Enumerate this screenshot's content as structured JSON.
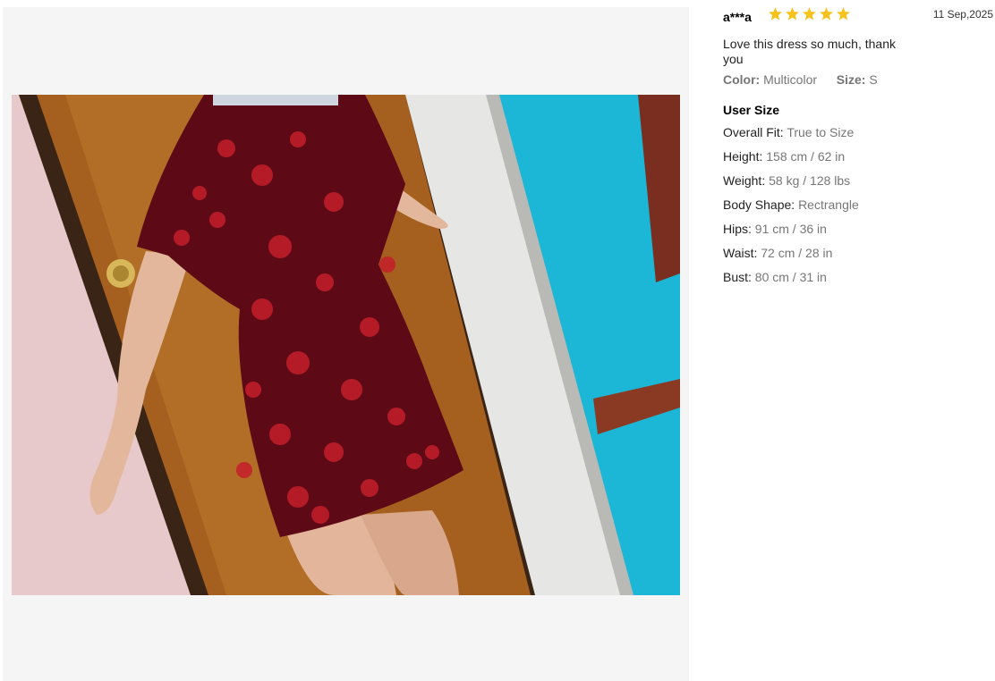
{
  "review": {
    "reviewer": "a***a",
    "rating": 5,
    "date": "11 Sep,2025",
    "text": "Love this dress so much, thank you",
    "color_label": "Color:",
    "color_value": "Multicolor",
    "size_label": "Size:",
    "size_value": "S"
  },
  "user_size": {
    "title": "User Size",
    "items": [
      {
        "label": "Overall Fit:",
        "value": "True to Size"
      },
      {
        "label": "Height:",
        "value": "158 cm / 62 in"
      },
      {
        "label": "Weight:",
        "value": "58 kg / 128 lbs"
      },
      {
        "label": "Body Shape:",
        "value": "Rectrangle"
      },
      {
        "label": "Hips:",
        "value": "91 cm / 36 in"
      },
      {
        "label": "Waist:",
        "value": "72 cm / 28 in"
      },
      {
        "label": "Bust:",
        "value": "80 cm / 31 in"
      }
    ]
  },
  "colors": {
    "star": "#f7c21b",
    "panel_bg": "#f5f5f5",
    "muted_text": "#767676"
  },
  "icons": {
    "star": "star-icon"
  }
}
